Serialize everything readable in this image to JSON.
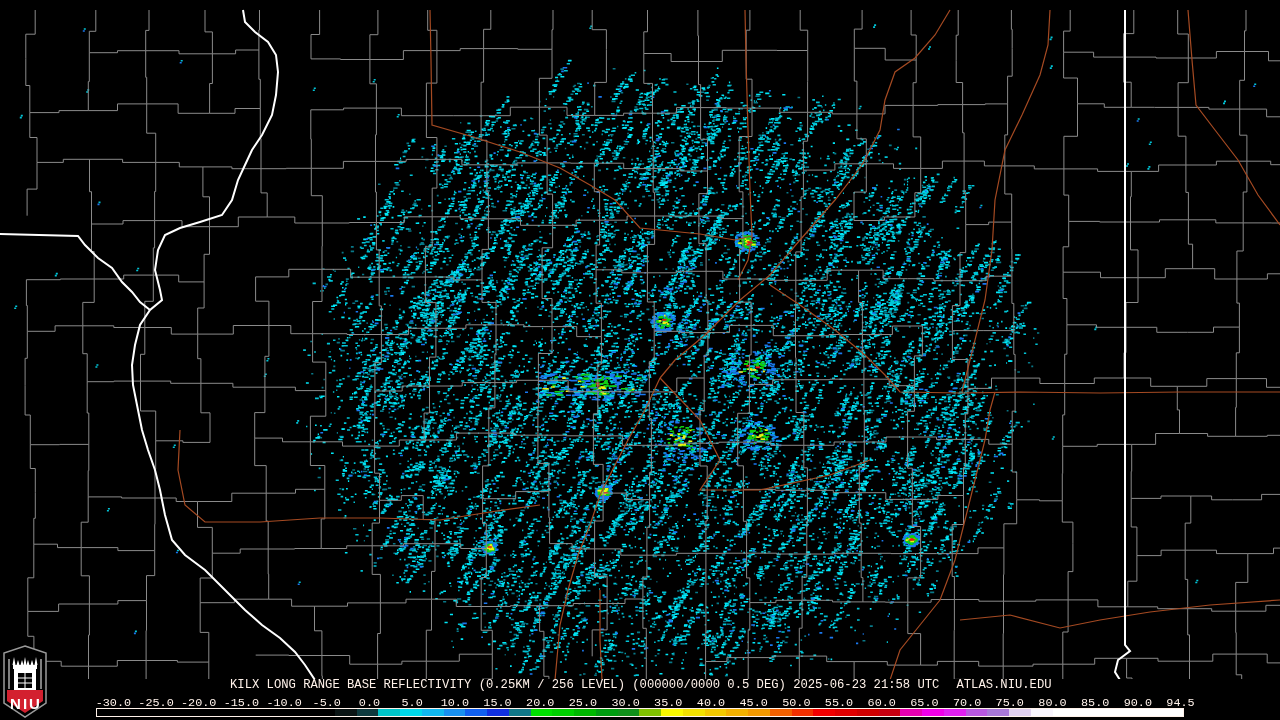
{
  "logo": {
    "text": "NIU"
  },
  "title": {
    "text": "KILX LONG RANGE BASE REFLECTIVITY (0.25KM / 256 LEVEL) (000000/0000 0.5 DEG) 2025-06-23 21:58 UTC",
    "source": "ATLAS.NIU.EDU"
  },
  "legend": {
    "ticks": [
      "-30.0",
      "-25.0",
      "-20.0",
      "-15.0",
      "-10.0",
      "-5.0",
      "0.0",
      "5.0",
      "10.0",
      "15.0",
      "20.0",
      "25.0",
      "30.0",
      "35.0",
      "40.0",
      "45.0",
      "50.0",
      "55.0",
      "60.0",
      "65.0",
      "70.0",
      "75.0",
      "80.0",
      "85.0",
      "90.0",
      "94.5"
    ],
    "segments": [
      {
        "color": "#0a1414"
      },
      {
        "color": "#0e3a3e"
      },
      {
        "color": "#00c4c8"
      },
      {
        "color": "#00d8ea"
      },
      {
        "color": "#10b8f0"
      },
      {
        "color": "#1890f0"
      },
      {
        "color": "#1060f0"
      },
      {
        "color": "#1030e0"
      },
      {
        "color": "#107888"
      },
      {
        "color": "#00e000"
      },
      {
        "color": "#00d000"
      },
      {
        "color": "#00b800"
      },
      {
        "color": "#009c10"
      },
      {
        "color": "#10901a"
      },
      {
        "color": "#80c000"
      },
      {
        "color": "#f8f800"
      },
      {
        "color": "#f0e000"
      },
      {
        "color": "#f0c800"
      },
      {
        "color": "#f0b000"
      },
      {
        "color": "#f09800"
      },
      {
        "color": "#f06000"
      },
      {
        "color": "#f03000"
      },
      {
        "color": "#f00000"
      },
      {
        "color": "#e00000"
      },
      {
        "color": "#d00000"
      },
      {
        "color": "#c80010"
      },
      {
        "color": "#e800b0"
      },
      {
        "color": "#f000e8"
      },
      {
        "color": "#e020f0"
      },
      {
        "color": "#b858e0"
      },
      {
        "color": "#a878d8"
      },
      {
        "color": "#e0d0f0"
      },
      {
        "color": "#f8f4fc"
      },
      {
        "color": "#ffffff"
      },
      {
        "color": "#ffffff"
      },
      {
        "color": "#ffffff"
      },
      {
        "color": "#ffffff"
      },
      {
        "color": "#ffffff"
      },
      {
        "color": "#ffffff"
      }
    ]
  }
}
